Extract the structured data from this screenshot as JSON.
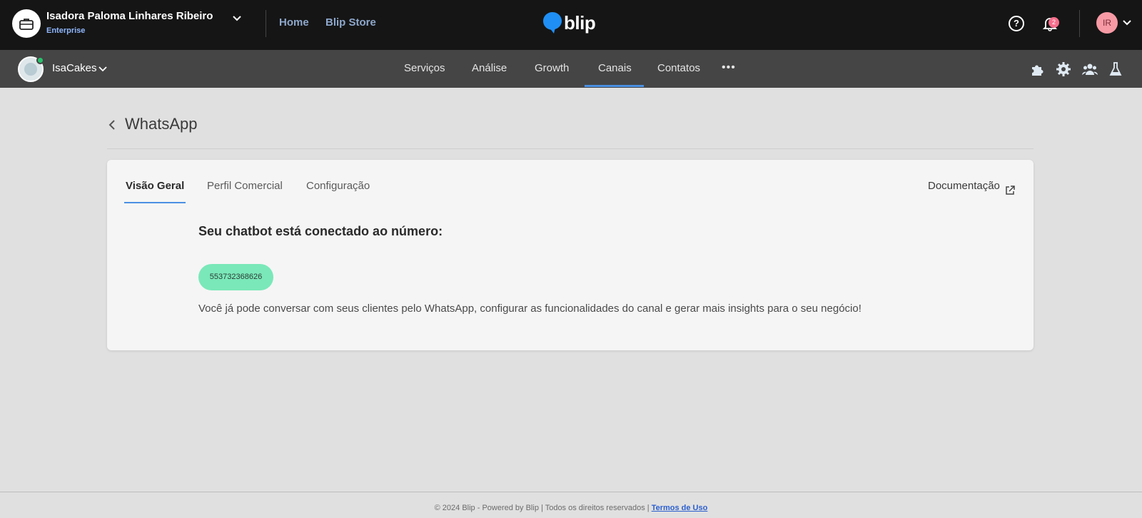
{
  "topbar": {
    "org_name": "Isadora Paloma Linhares Ribeiro",
    "org_plan": "Enterprise",
    "links": [
      "Home",
      "Blip Store"
    ],
    "logo_text": "blip",
    "notification_count": "2",
    "user_initials": "IR"
  },
  "subnav": {
    "bot_name": "IsaCakes",
    "items": [
      "Serviços",
      "Análise",
      "Growth",
      "Canais",
      "Contatos"
    ],
    "active_item": "Canais",
    "more": "•••"
  },
  "page": {
    "title": "WhatsApp"
  },
  "card": {
    "tabs": [
      "Visão Geral",
      "Perfil Comercial",
      "Configuração"
    ],
    "active_tab": "Visão Geral",
    "doc_link": "Documentação",
    "connected_title": "Seu chatbot está conectado ao número:",
    "phone_number": "553732368626",
    "description": "Você já pode conversar com seus clientes pelo WhatsApp, configurar as funcionalidades do canal e gerar mais insights para o seu negócio!"
  },
  "footer": {
    "text": "© 2024 Blip - Powered by Blip | Todos os direitos reservados | ",
    "terms": "Termos de Uso"
  },
  "colors": {
    "topbar": "#151515",
    "subnav": "#454545",
    "accent": "#4a90e2",
    "phone_chip": "#7ae8b9",
    "badge": "#f76e8c"
  }
}
